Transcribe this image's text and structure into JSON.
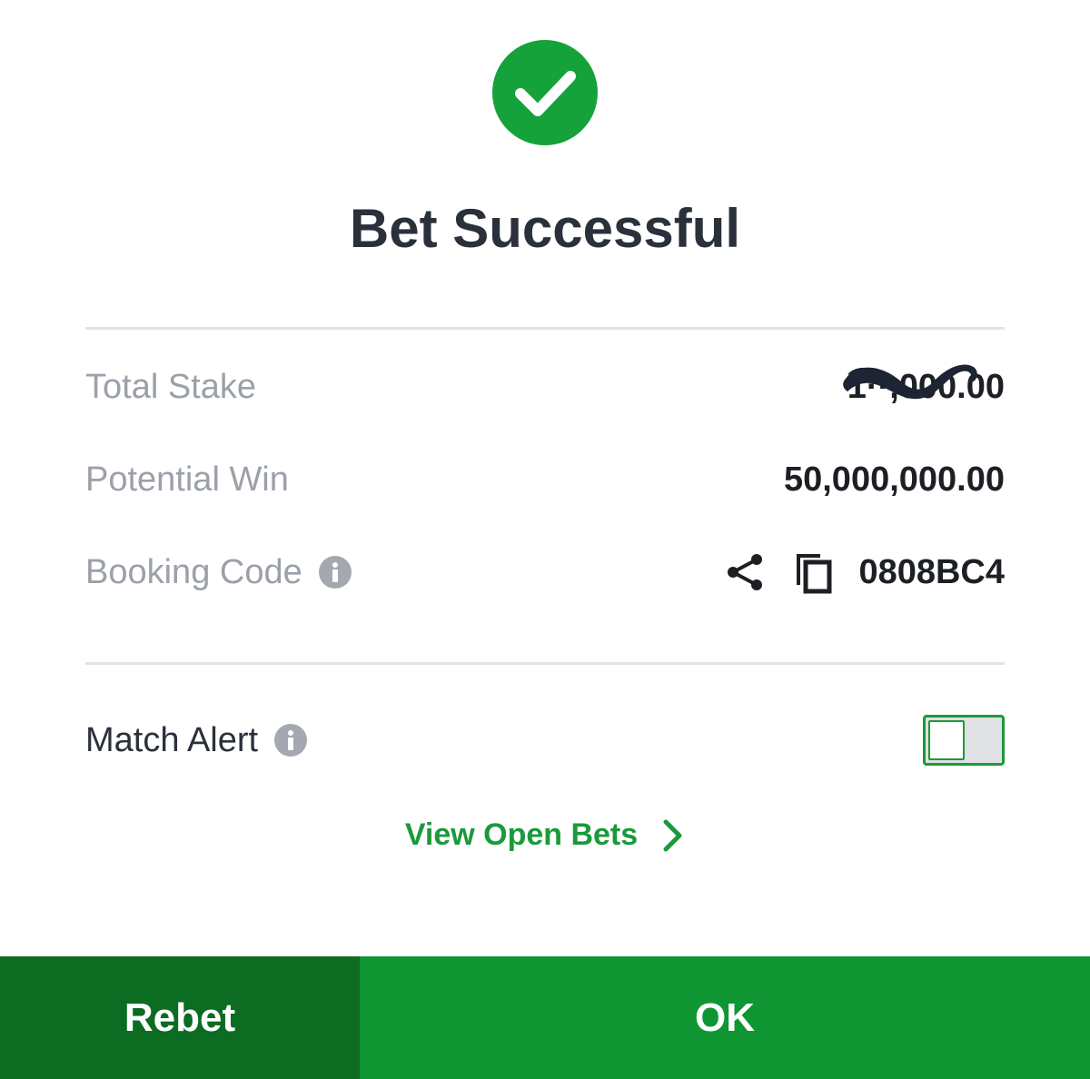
{
  "title": "Bet Successful",
  "summary": {
    "total_stake_label": "Total Stake",
    "total_stake_value": "1··,000.00",
    "potential_win_label": "Potential Win",
    "potential_win_value": "50,000,000.00",
    "booking_code_label": "Booking Code",
    "booking_code_value": "0808BC4"
  },
  "match_alert": {
    "label": "Match Alert",
    "enabled": false
  },
  "view_open_bets_label": "View Open Bets",
  "footer": {
    "rebet_label": "Rebet",
    "ok_label": "OK"
  },
  "colors": {
    "accent_green": "#0f9633",
    "dark_green": "#0b6c22",
    "success_icon": "#15a23a",
    "title_text": "#2b313b",
    "muted_text": "#9ba0a9"
  },
  "icons": [
    "check-circle-icon",
    "info-icon",
    "share-icon",
    "copy-icon",
    "chevron-right-icon",
    "mustache-scribble"
  ]
}
